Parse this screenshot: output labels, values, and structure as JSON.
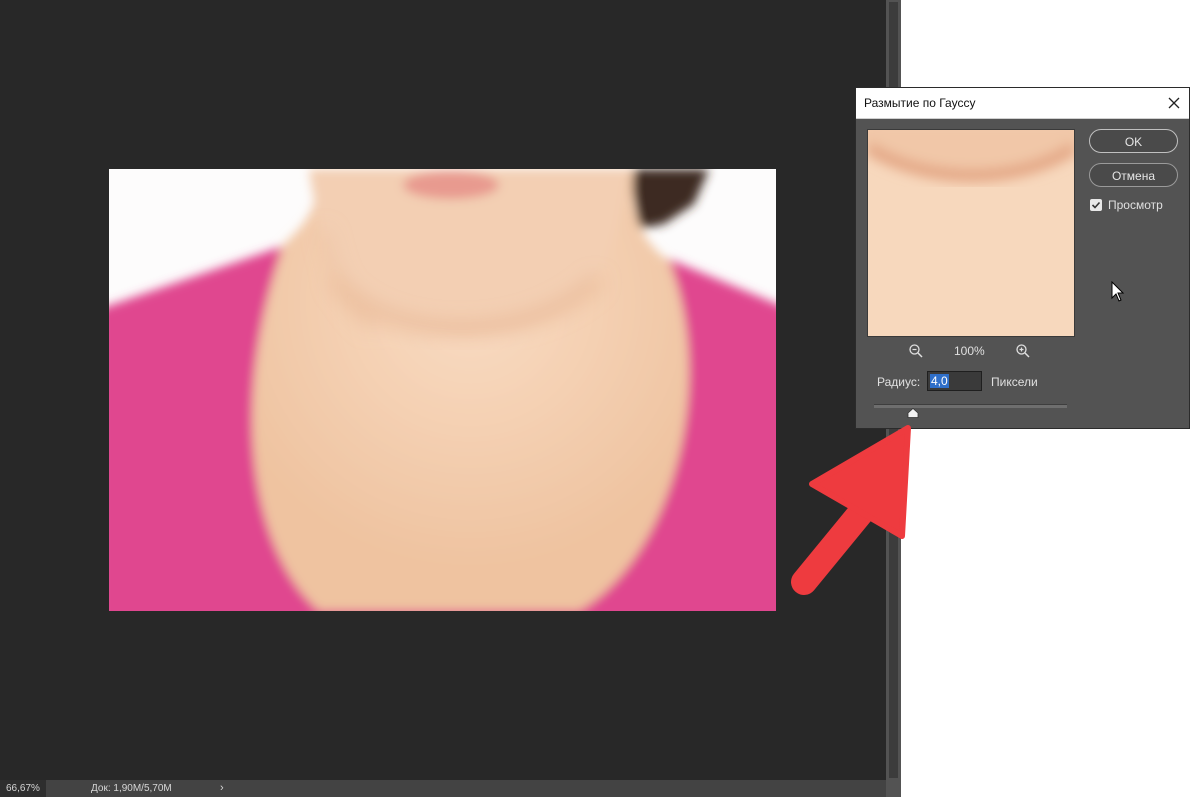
{
  "statusbar": {
    "zoom": "66,67%",
    "doc_info": "Док: 1,90M/5,70M",
    "expand_arrow": "›"
  },
  "dialog": {
    "title": "Размытие по Гауссу",
    "ok_label": "OK",
    "cancel_label": "Отмена",
    "preview_label": "Просмотр",
    "preview_checked": true,
    "zoom_level": "100%",
    "radius_label": "Радиус:",
    "radius_value": "4,0",
    "unit_label": "Пиксели",
    "slider_fraction": 0.2
  },
  "icons": {
    "close": "close-icon",
    "zoom_out": "zoom-out-icon",
    "zoom_in": "zoom-in-icon",
    "checkbox": "checkmark-icon",
    "slider": "slider-thumb-icon",
    "cursor": "mouse-cursor-icon",
    "annotation": "red-arrow-icon"
  },
  "colors": {
    "workspace": "#282828",
    "dialog_bg": "#535353",
    "shirt_pink": "#e0468f",
    "skin": "#f6d4b8",
    "annotation_red": "#ee3b3f"
  }
}
